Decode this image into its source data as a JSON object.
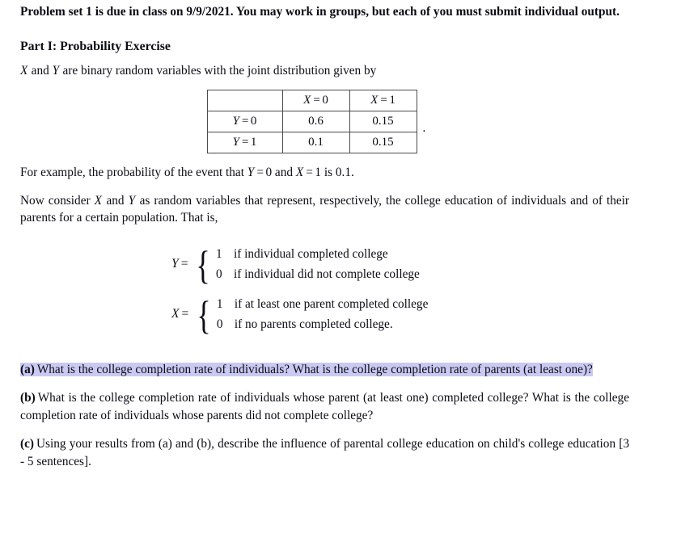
{
  "document": {
    "intro": "Problem set 1 is due in class on 9/9/2021. You may work in groups, but each of you must submit individual output.",
    "section_heading": "Part I: Probability Exercise",
    "lead_in_pre": "",
    "lead_in": {
      "var_x": "X",
      "and": " and ",
      "var_y": "Y",
      "rest": " are binary random variables with the joint distribution given by"
    },
    "table": {
      "corner": "",
      "column_headers": [
        "X = 0",
        "X = 1"
      ],
      "row_headers": [
        "Y = 0",
        "Y = 1"
      ],
      "rows": [
        {
          "header": "Y = 0",
          "values": [
            "0.6",
            "0.15"
          ]
        },
        {
          "header": "Y = 1",
          "values": [
            "0.1",
            "0.15"
          ]
        }
      ],
      "trailing_punctuation": "."
    },
    "example_text": {
      "prefix": "For example, the probability of the event that ",
      "y_eq": "Y = 0",
      "mid": " and ",
      "x_eq": "X = 1",
      "suffix": " is 0.1."
    },
    "now_consider": {
      "prefix": "Now consider ",
      "var_x": "X",
      "and": " and ",
      "var_y": "Y",
      "rest": " as random variables that represent, respectively, the college education of individuals and of their parents for a certain population. That is,"
    },
    "definitions": [
      {
        "lhs_var": "Y",
        "lhs_eq": "=",
        "cases": [
          {
            "value": "1",
            "text": "if individual completed college"
          },
          {
            "value": "0",
            "text": "if individual did not complete college"
          }
        ]
      },
      {
        "lhs_var": "X",
        "lhs_eq": "=",
        "cases": [
          {
            "value": "1",
            "text": "if at least one parent completed college"
          },
          {
            "value": "0",
            "text": "if no parents completed college."
          }
        ]
      }
    ],
    "parts": [
      {
        "label": "(a)",
        "text": "What is the college completion rate of individuals?  What is the college completion rate of parents (at least one)?",
        "highlighted": true
      },
      {
        "label": "(b)",
        "text": "What is the college completion rate of individuals whose parent (at least one) completed college? What is the college completion rate of individuals whose parents did not complete college?",
        "highlighted": false
      },
      {
        "label": "(c)",
        "text": "Using your results from (a) and (b), describe the influence of parental college education on child's college education [3 - 5 sentences].",
        "highlighted": false
      }
    ]
  },
  "colors": {
    "highlight": "#c9c9f2",
    "text": "#0c0c14",
    "table_border": "#4a4a4a",
    "background": "#ffffff"
  }
}
